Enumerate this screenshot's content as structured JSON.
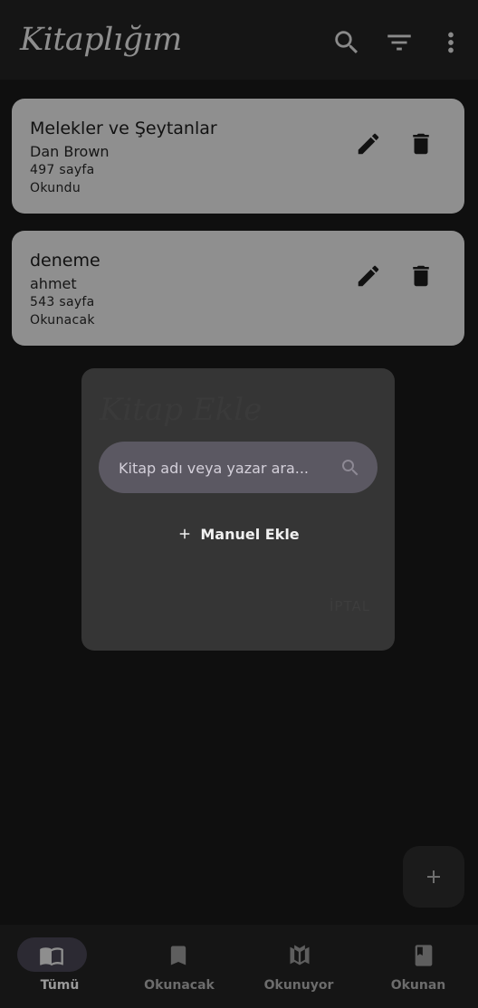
{
  "app_title": "Kitaplığım",
  "toolbar": {
    "icons": [
      "search-icon",
      "filter-icon",
      "more-vert-icon"
    ]
  },
  "books": [
    {
      "title": "Melekler ve Şeytanlar",
      "author": "Dan Brown",
      "pages": "497 sayfa",
      "status": "Okundu"
    },
    {
      "title": "deneme",
      "author": "ahmet",
      "pages": "543 sayfa",
      "status": "Okunacak"
    }
  ],
  "dialog": {
    "title": "Kitap Ekle",
    "search_placeholder": "Kitap adı veya yazar ara...",
    "manual_add_label": "Manuel Ekle",
    "cancel_label": "İPTAL"
  },
  "bottom_nav": [
    {
      "label": "Tümü",
      "icon": "book-open-icon",
      "active": true
    },
    {
      "label": "Okunacak",
      "icon": "bookmark-icon",
      "active": false
    },
    {
      "label": "Okunuyor",
      "icon": "reading-icon",
      "active": false
    },
    {
      "label": "Okunan",
      "icon": "book-icon",
      "active": false
    }
  ],
  "colors": {
    "card": "#8f8f8f",
    "dialog": "#353535",
    "search": "#5b5862",
    "nav_pill": "#2c2a33"
  }
}
